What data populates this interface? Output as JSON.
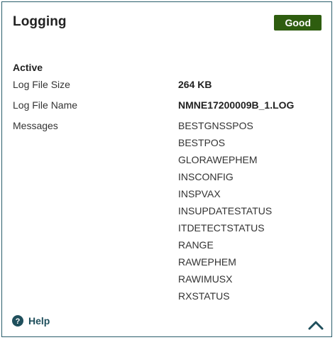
{
  "card": {
    "title": "Logging",
    "status": "Good"
  },
  "section": {
    "heading": "Active"
  },
  "rows": {
    "log_file_size": {
      "label": "Log File Size",
      "value": "264 KB"
    },
    "log_file_name": {
      "label": "Log File Name",
      "value": "NMNE17200009B_1.LOG"
    },
    "messages": {
      "label": "Messages",
      "values": [
        "BESTGNSSPOS",
        "BESTPOS",
        "GLORAWEPHEM",
        "INSCONFIG",
        "INSPVAX",
        "INSUPDATESTATUS",
        "ITDETECTSTATUS",
        "RANGE",
        "RAWEPHEM",
        "RAWIMUSX",
        "RXSTATUS"
      ]
    }
  },
  "footer": {
    "help_label": "Help",
    "help_icon": "question-circle-icon",
    "collapse_icon": "chevron-up-icon"
  },
  "colors": {
    "border": "#2a5d6b",
    "status_good": "#2e5d0f",
    "accent": "#1f4f5c"
  }
}
